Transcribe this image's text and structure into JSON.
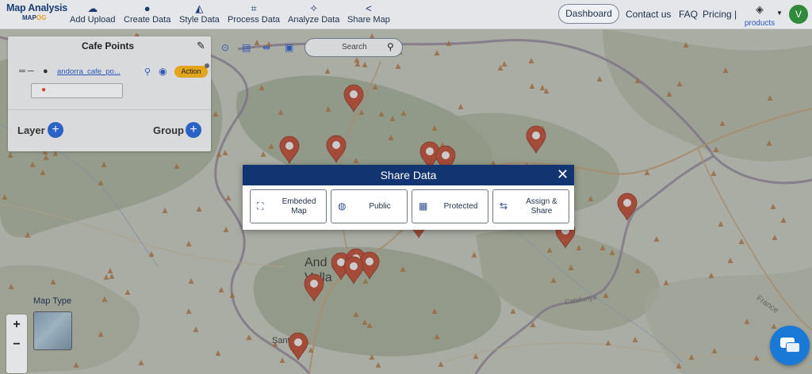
{
  "app": {
    "logo_line1": "Map Analysis",
    "logo_line2_a": "MAP",
    "logo_line2_b": "OG"
  },
  "nav": [
    {
      "label": "Add Upload",
      "icon": "cloud-upload-icon"
    },
    {
      "label": "Create Data",
      "icon": "map-pin-icon"
    },
    {
      "label": "Style Data",
      "icon": "paint-bucket-icon"
    },
    {
      "label": "Process Data",
      "icon": "process-nodes-icon"
    },
    {
      "label": "Analyze Data",
      "icon": "satellite-icon"
    },
    {
      "label": "Share Map",
      "icon": "share-icon"
    }
  ],
  "header_right": {
    "dashboard": "Dashboard",
    "contact": "Contact us",
    "faq": "FAQ",
    "pricing": "Pricing |",
    "products": "products",
    "avatar_initial": "V"
  },
  "layer_panel": {
    "title": "Cafe Points",
    "layer_name": "andorra_cafe_po...",
    "action_label": "Action",
    "layer_label": "Layer",
    "group_label": "Group"
  },
  "toolbar": {
    "search_placeholder": "Search"
  },
  "map": {
    "map_type_label": "Map Type",
    "zoom_in": "+",
    "zoom_out": "−",
    "place_labels": [
      "And",
      "Vella",
      "Sant",
      "de",
      "Catalunya",
      "France"
    ]
  },
  "modal": {
    "title": "Share Data",
    "options": [
      {
        "line1": "Embeded",
        "line2": "Map",
        "icon": "embed-map-icon"
      },
      {
        "line1": "Public",
        "line2": "",
        "icon": "public-globe-icon"
      },
      {
        "line1": "Protected",
        "line2": "",
        "icon": "protected-lock-icon"
      },
      {
        "line1": "Assign &",
        "line2": "Share",
        "icon": "assign-share-icon"
      }
    ]
  },
  "colors": {
    "header_bg": "#e4e6ea",
    "brand_navy": "#123470",
    "marker_red": "#c8442b",
    "accent_blue": "#2a62c6",
    "action_orange": "#e3a51c"
  }
}
